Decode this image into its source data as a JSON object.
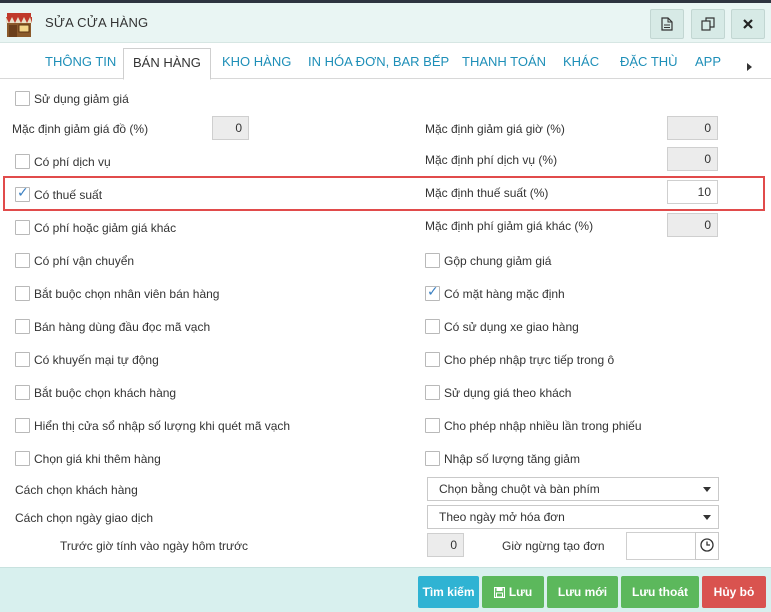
{
  "window": {
    "title": "SỬA CỬA HÀNG"
  },
  "tabs": [
    {
      "label": "THÔNG TIN"
    },
    {
      "label": "BÁN HÀNG"
    },
    {
      "label": "KHO HÀNG"
    },
    {
      "label": "IN HÓA ĐƠN, BAR BẾP"
    },
    {
      "label": "THANH TOÁN"
    },
    {
      "label": "KHÁC"
    },
    {
      "label": "ĐẶC THÙ"
    },
    {
      "label": "APP"
    }
  ],
  "form": {
    "use_discount": {
      "label": "Sử dụng giảm giá",
      "checked": false
    },
    "default_item_discount": {
      "label": "Mặc định giảm giá đồ (%)",
      "value": "0"
    },
    "default_hour_discount": {
      "label": "Mặc định giảm giá giờ (%)",
      "value": "0"
    },
    "service_fee": {
      "label": "Có phí dịch vụ",
      "checked": false
    },
    "default_service_fee": {
      "label": "Mặc định phí dịch vụ (%)",
      "value": "0"
    },
    "tax": {
      "label": "Có thuế suất",
      "checked": true
    },
    "default_tax": {
      "label": "Mặc định thuế suất (%)",
      "value": "10"
    },
    "other_fee": {
      "label": "Có phí hoặc giảm giá khác",
      "checked": false
    },
    "default_other_fee": {
      "label": "Mặc định phí giảm giá khác (%)",
      "value": "0"
    },
    "left_checks": [
      {
        "label": "Có phí vận chuyển",
        "checked": false
      },
      {
        "label": "Bắt buộc chọn nhân viên bán hàng",
        "checked": false
      },
      {
        "label": "Bán hàng dùng đầu đọc mã vạch",
        "checked": false
      },
      {
        "label": "Có khuyến mại tự động",
        "checked": false
      },
      {
        "label": "Bắt buộc chọn khách hàng",
        "checked": false
      },
      {
        "label": "Hiển thị cửa sổ nhập số lượng khi quét mã vạch",
        "checked": false
      },
      {
        "label": "Chọn giá khi thêm hàng",
        "checked": false
      }
    ],
    "right_checks": [
      {
        "label": "Gộp chung giảm giá",
        "checked": false
      },
      {
        "label": "Có mặt hàng mặc định",
        "checked": true
      },
      {
        "label": "Có sử dụng xe giao hàng",
        "checked": false
      },
      {
        "label": "Cho phép nhập trực tiếp trong ô",
        "checked": false
      },
      {
        "label": "Sử dụng giá theo khách",
        "checked": false
      },
      {
        "label": "Cho phép nhập nhiều lần trong phiếu",
        "checked": false
      },
      {
        "label": "Nhập số lượng tăng giảm",
        "checked": false
      }
    ],
    "customer_select": {
      "label": "Cách chọn khách hàng",
      "value": "Chọn bằng chuột và bàn phím"
    },
    "date_select": {
      "label": "Cách chọn ngày giao dịch",
      "value": "Theo ngày mở hóa đơn"
    },
    "hours_before": {
      "label": "Trước giờ tính vào ngày hôm trước",
      "value": "0"
    },
    "stop_time": {
      "label": "Giờ ngừng tạo đơn",
      "value": ""
    }
  },
  "footer": {
    "search": "Tìm kiếm",
    "save": "Lưu",
    "save_new": "Lưu mới",
    "save_exit": "Lưu thoát",
    "cancel": "Hủy bỏ"
  },
  "colors": {
    "header_bg": "#e9f5f3",
    "tab_link": "#1e8fb8",
    "highlight": "#e14b4b",
    "btn_search": "#2fb3d3",
    "btn_save": "#5cb85c",
    "btn_cancel": "#d9534f"
  }
}
